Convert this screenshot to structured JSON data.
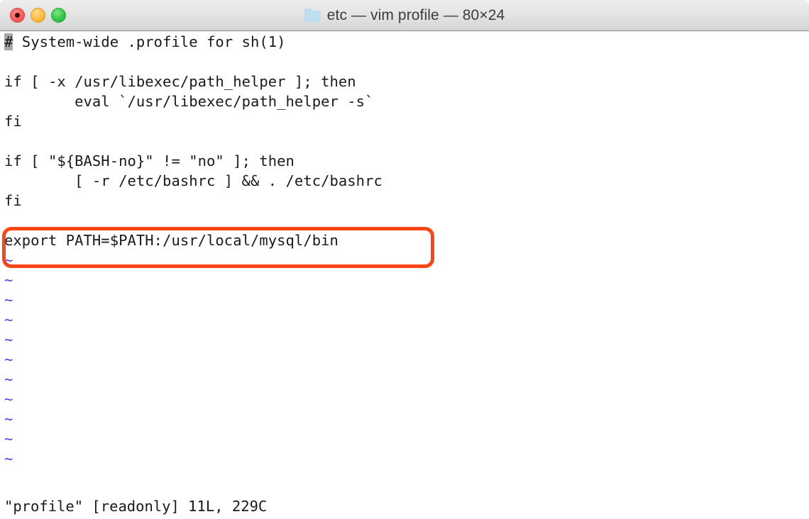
{
  "window": {
    "title": "etc — vim profile — 80×24",
    "folder_icon": "folder-icon",
    "controls": {
      "close_label": "close",
      "minimize_label": "minimize",
      "maximize_label": "maximize"
    }
  },
  "colors": {
    "annotation": "#fa4616",
    "tilde": "#4e3ced",
    "cursor": "#a8a8a8",
    "close": "#f8605a",
    "minimize": "#fcbc40",
    "maximize": "#34c845",
    "titlebar_top": "#ededed",
    "titlebar_bottom": "#d2d2d2",
    "text": "#1a1a1a",
    "background": "#ffffff"
  },
  "editor": {
    "file_lines": [
      {
        "cursor_char": "#",
        "rest": " System-wide .profile for sh(1)"
      },
      {
        "cursor_char": "",
        "rest": ""
      },
      {
        "cursor_char": "",
        "rest": "if [ -x /usr/libexec/path_helper ]; then"
      },
      {
        "cursor_char": "",
        "rest": "        eval `/usr/libexec/path_helper -s`"
      },
      {
        "cursor_char": "",
        "rest": "fi"
      },
      {
        "cursor_char": "",
        "rest": ""
      },
      {
        "cursor_char": "",
        "rest": "if [ \"${BASH-no}\" != \"no\" ]; then"
      },
      {
        "cursor_char": "",
        "rest": "        [ -r /etc/bashrc ] && . /etc/bashrc"
      },
      {
        "cursor_char": "",
        "rest": "fi"
      },
      {
        "cursor_char": "",
        "rest": ""
      },
      {
        "cursor_char": "",
        "rest": "export PATH=$PATH:/usr/local/mysql/bin"
      }
    ],
    "tilde_marker": "~",
    "tilde_count": 11,
    "status_line": "\"profile\" [readonly] 11L, 229C",
    "annotated_line": "export PATH=$PATH:/usr/local/mysql/bin"
  }
}
